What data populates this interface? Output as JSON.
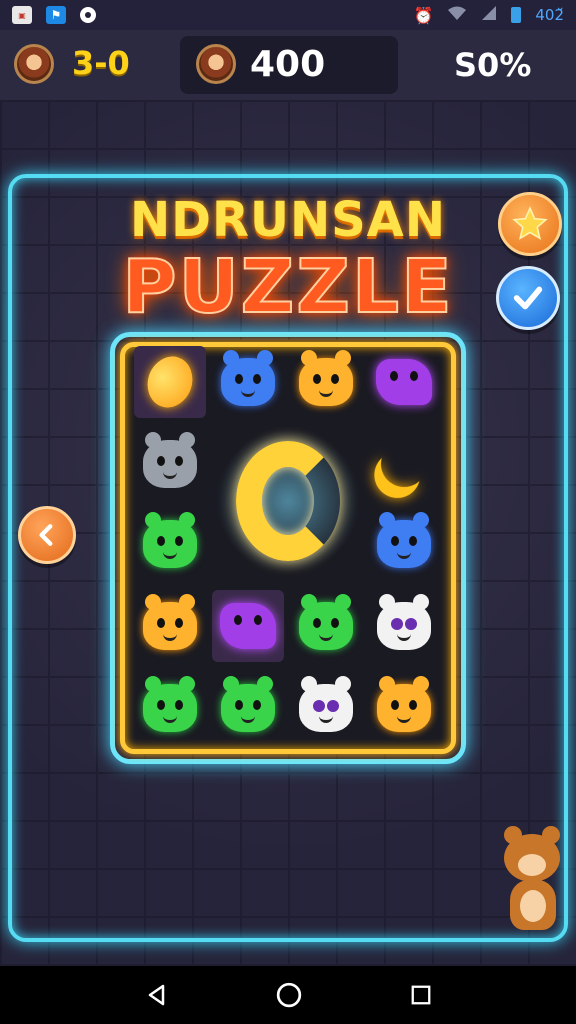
{
  "status_bar": {
    "left_icons": [
      "news-icon",
      "app-icon",
      "camera-icon"
    ],
    "right_icons": [
      "alarm-icon",
      "wifi-icon",
      "signal-icon",
      "battery-icon"
    ],
    "battery_text": "402̆"
  },
  "top_bar": {
    "level": "3-0",
    "score": "400",
    "percent": "S0%"
  },
  "title": {
    "line1": "NDRUNSAN",
    "line2": "PUZZLE"
  },
  "buttons": {
    "star": "star-icon",
    "check": "check-icon",
    "back": "chevron-left-icon"
  },
  "tiles": [
    {
      "kind": "carrot-gem",
      "color": "#ffb000"
    },
    {
      "kind": "blue-bear",
      "color": "#3f7df2"
    },
    {
      "kind": "orange-bear",
      "color": "#ffb22e"
    },
    {
      "kind": "purple-blob",
      "color": "#a13ee8"
    },
    {
      "kind": "gray-cat",
      "color": "#9aa0aa"
    },
    {
      "kind": "yellow-moon",
      "color": "#ffc21a"
    },
    {
      "kind": "green-frog",
      "color": "#3ad44a"
    },
    {
      "kind": "blue-bear",
      "color": "#3f7df2"
    },
    {
      "kind": "orange-bear",
      "color": "#ffb22e"
    },
    {
      "kind": "purple-blob",
      "color": "#a13ee8"
    },
    {
      "kind": "green-cat",
      "color": "#3ad44a"
    },
    {
      "kind": "panda",
      "color": "#f2f2f2"
    },
    {
      "kind": "green-cat",
      "color": "#3ad44a"
    },
    {
      "kind": "green-frog",
      "color": "#3ad44a"
    },
    {
      "kind": "panda",
      "color": "#f2f2f2"
    },
    {
      "kind": "orange-bear",
      "color": "#ffb22e"
    }
  ],
  "center_piece": "yellow-ring",
  "colors": {
    "neon_cyan": "#56dcf2",
    "neon_yellow": "#ffc93a",
    "title_yellow": "#ffe24a",
    "title_orange": "#ff5a1f"
  },
  "nav_bar": [
    "back-triangle-icon",
    "home-circle-icon",
    "recents-square-icon"
  ]
}
